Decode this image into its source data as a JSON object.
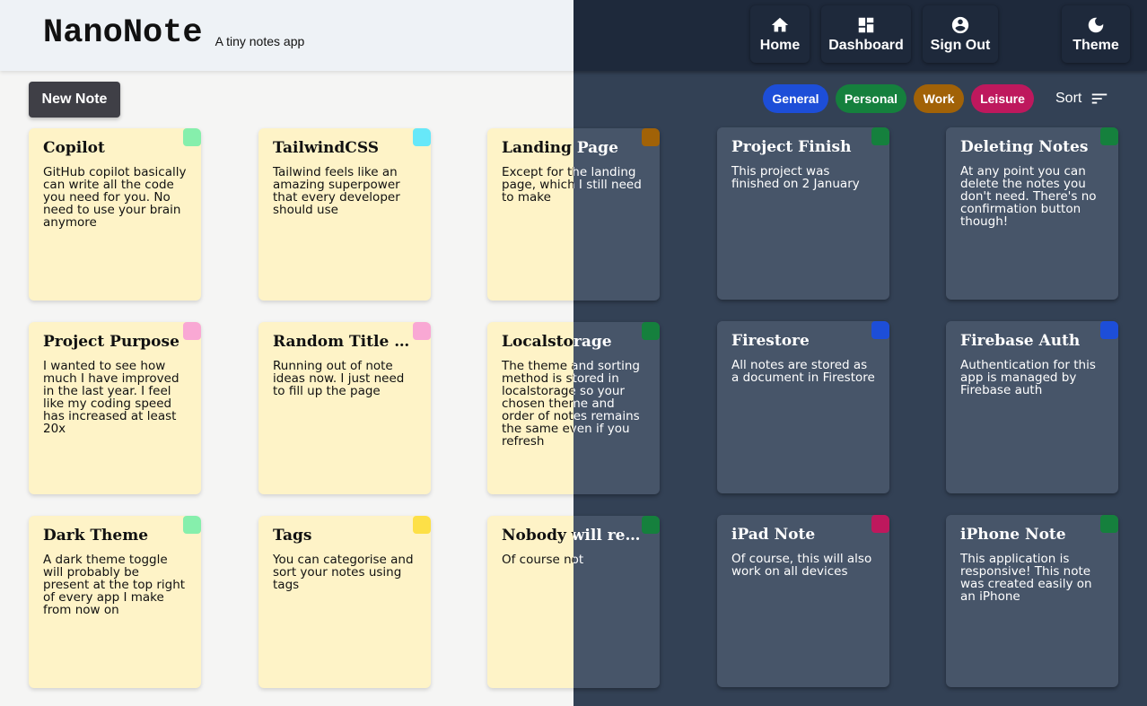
{
  "app": {
    "title": "NanoNote",
    "subtitle": "A tiny notes app"
  },
  "nav": {
    "home": {
      "label": "Home",
      "icon": "home-icon"
    },
    "dashboard": {
      "label": "Dashboard",
      "icon": "dashboard-icon"
    },
    "signout": {
      "label": "Sign Out",
      "icon": "account-circle-icon"
    },
    "theme": {
      "label": "Theme",
      "icon": "moon-icon"
    }
  },
  "toolbar": {
    "new_note_label": "New Note",
    "sort_label": "Sort",
    "tags": [
      {
        "label": "General",
        "color": "#1d4ed8"
      },
      {
        "label": "Personal",
        "color": "#15803d"
      },
      {
        "label": "Work",
        "color": "#a16207"
      },
      {
        "label": "Leisure",
        "color": "#be185d"
      }
    ]
  },
  "notes": [
    {
      "title": "Copilot",
      "body": "GitHub copilot basically can write all the code you need for you. No need to use your brain anymore",
      "tag_color": "#86efac"
    },
    {
      "title": "TailwindCSS",
      "body": "Tailwind feels like an amazing superpower that every developer should use",
      "tag_color": "#67e8f9"
    },
    {
      "title": "Landing Page",
      "body": "Except for the landing page, which I still need to make",
      "tag_color": "#a16207"
    },
    {
      "title": "Project Finish",
      "body": "This project was finished on 2 January",
      "tag_color": "#15803d"
    },
    {
      "title": "Deleting Notes",
      "body": "At any point you can delete the notes you don't need. There's no confirmation button though!",
      "tag_color": "#15803d"
    },
    {
      "title": "Project Purpose",
      "body": "I wanted to see how much I have improved in the last year. I feel like my coding speed has increased at least 20x",
      "tag_color": "#f9a8d4"
    },
    {
      "title": "Random Title O.o",
      "body": "Running out of note ideas now. I just need to fill up the page",
      "tag_color": "#f9a8d4"
    },
    {
      "title": "Localstorage",
      "body": "The theme and sorting method is stored in localstorage so your chosen theme and order of notes remains the same even if you refresh",
      "tag_color": "#15803d"
    },
    {
      "title": "Firestore",
      "body": "All notes are stored as a document in Firestore",
      "tag_color": "#1d4ed8"
    },
    {
      "title": "Firebase Auth",
      "body": "Authentication for this app is managed by Firebase auth",
      "tag_color": "#1d4ed8"
    },
    {
      "title": "Dark Theme",
      "body": "A dark theme toggle will probably be present at the top right of every app I make from now on",
      "tag_color": "#86efac"
    },
    {
      "title": "Tags",
      "body": "You can categorise and sort your notes using tags",
      "tag_color": "#fde047"
    },
    {
      "title": "Nobody will read this",
      "body": "Of course not",
      "tag_color": "#15803d"
    },
    {
      "title": "iPad Note",
      "body": "Of course, this will also work on all devices",
      "tag_color": "#be185d"
    },
    {
      "title": "iPhone Note",
      "body": "This application is responsive! This note was created easily on an iPhone",
      "tag_color": "#15803d"
    }
  ]
}
